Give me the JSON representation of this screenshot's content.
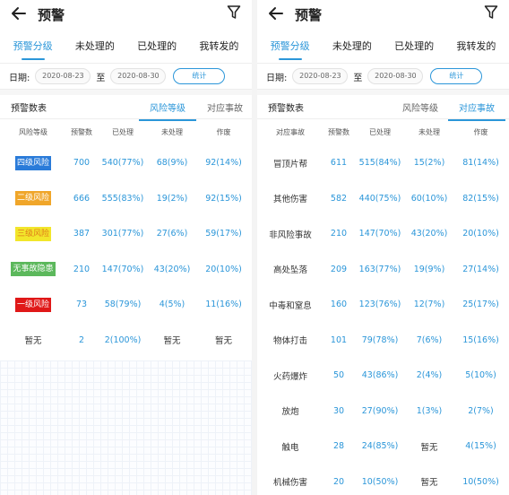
{
  "colors": {
    "accent": "#2b96d9",
    "level4": "#2a7bd9",
    "level3": "#f0a62a",
    "level2": "#f2e62b",
    "no_hazard": "#5cb85c",
    "level1": "#e01818"
  },
  "screens": {
    "left": {
      "title": "预警",
      "tabs": [
        "预警分级",
        "未处理的",
        "已处理的",
        "我转发的"
      ],
      "date_label": "日期:",
      "date_from": "2020-08-23",
      "to_label": "至",
      "date_to": "2020-08-30",
      "stat_button": "统计",
      "section_title": "预警数表",
      "subtabs": [
        "风险等级",
        "对应事故"
      ],
      "columns": [
        "风险等级",
        "预警数",
        "已处理",
        "未处理",
        "作废"
      ],
      "rows": [
        {
          "category": "四级风险",
          "count": "700",
          "handled": "540(77%)",
          "unhandled": "68(9%)",
          "voided": "92(14%)"
        },
        {
          "category": "二级风险",
          "count": "666",
          "handled": "555(83%)",
          "unhandled": "19(2%)",
          "voided": "92(15%)"
        },
        {
          "category": "三级风险",
          "count": "387",
          "handled": "301(77%)",
          "unhandled": "27(6%)",
          "voided": "59(17%)"
        },
        {
          "category": "无事故隐患",
          "count": "210",
          "handled": "147(70%)",
          "unhandled": "43(20%)",
          "voided": "20(10%)"
        },
        {
          "category": "一级风险",
          "count": "73",
          "handled": "58(79%)",
          "unhandled": "4(5%)",
          "voided": "11(16%)"
        },
        {
          "category": "暂无",
          "count": "2",
          "handled": "2(100%)",
          "unhandled": "暂无",
          "voided": "暂无"
        }
      ]
    },
    "right": {
      "title": "预警",
      "tabs": [
        "预警分级",
        "未处理的",
        "已处理的",
        "我转发的"
      ],
      "date_label": "日期:",
      "date_from": "2020-08-23",
      "to_label": "至",
      "date_to": "2020-08-30",
      "stat_button": "统计",
      "section_title": "预警数表",
      "subtabs": [
        "风险等级",
        "对应事故"
      ],
      "columns": [
        "对应事故",
        "预警数",
        "已处理",
        "未处理",
        "作废"
      ],
      "rows": [
        {
          "category": "冒顶片帮",
          "count": "611",
          "handled": "515(84%)",
          "unhandled": "15(2%)",
          "voided": "81(14%)"
        },
        {
          "category": "其他伤害",
          "count": "582",
          "handled": "440(75%)",
          "unhandled": "60(10%)",
          "voided": "82(15%)"
        },
        {
          "category": "非风险事故",
          "count": "210",
          "handled": "147(70%)",
          "unhandled": "43(20%)",
          "voided": "20(10%)"
        },
        {
          "category": "高处坠落",
          "count": "209",
          "handled": "163(77%)",
          "unhandled": "19(9%)",
          "voided": "27(14%)"
        },
        {
          "category": "中毒和窒息",
          "count": "160",
          "handled": "123(76%)",
          "unhandled": "12(7%)",
          "voided": "25(17%)"
        },
        {
          "category": "物体打击",
          "count": "101",
          "handled": "79(78%)",
          "unhandled": "7(6%)",
          "voided": "15(16%)"
        },
        {
          "category": "火药爆炸",
          "count": "50",
          "handled": "43(86%)",
          "unhandled": "2(4%)",
          "voided": "5(10%)"
        },
        {
          "category": "放炮",
          "count": "30",
          "handled": "27(90%)",
          "unhandled": "1(3%)",
          "voided": "2(7%)"
        },
        {
          "category": "触电",
          "count": "28",
          "handled": "24(85%)",
          "unhandled": "暂无",
          "voided": "4(15%)"
        },
        {
          "category": "机械伤害",
          "count": "20",
          "handled": "10(50%)",
          "unhandled": "暂无",
          "voided": "10(50%)"
        }
      ]
    }
  }
}
